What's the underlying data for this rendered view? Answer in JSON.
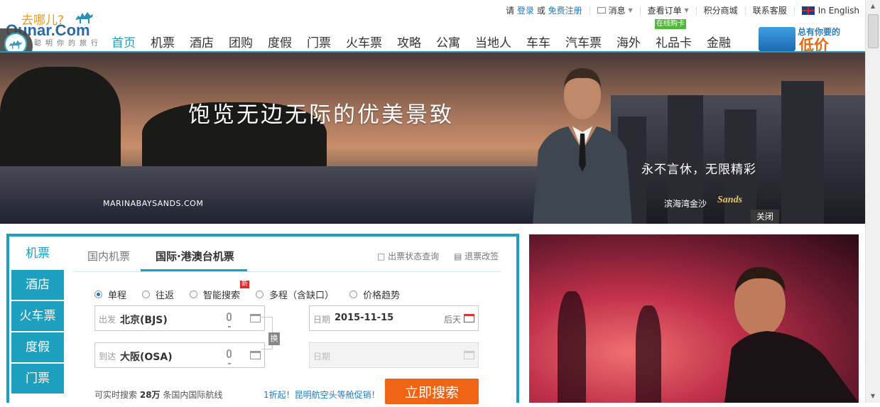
{
  "topbar": {
    "please": "请",
    "login": "登录",
    "or": "或",
    "register": "免费注册",
    "messages": "消息",
    "orders": "查看订单",
    "points_mall": "积分商城",
    "customer_service": "联系客服",
    "english": "In English"
  },
  "logo": {
    "cn": "去哪儿?",
    "en": "Qunar.Com",
    "slogan": "聪明你的旅行"
  },
  "nav": {
    "items": [
      "首页",
      "机票",
      "酒店",
      "团购",
      "度假",
      "门票",
      "火车票",
      "攻略",
      "公寓",
      "当地人",
      "车车",
      "汽车票",
      "海外",
      "礼品卡",
      "金融"
    ],
    "active": "首页",
    "giftcard_badge": "在线购卡"
  },
  "promo": {
    "line1": "总有你要的",
    "line2": "低价"
  },
  "banner": {
    "headline": "饱览无边无际的优美景致",
    "slogan": "永不言休，无限精彩",
    "url": "MARINABAYSANDS.COM",
    "brand_cn": "滨海湾金沙",
    "brand_en": "Sands",
    "close": "关闭"
  },
  "search": {
    "side_tabs": [
      "机票",
      "酒店",
      "火车票",
      "度假",
      "门票"
    ],
    "tabs": [
      "国内机票",
      "国际·港澳台机票"
    ],
    "status_link": "出票状态查询",
    "refund_link": "退票改签",
    "trip_types": [
      "单程",
      "往返",
      "智能搜索",
      "多程（含缺口）",
      "价格趋势"
    ],
    "new_badge": "新",
    "depart_label": "出发",
    "depart_value": "北京(BJS)",
    "arrive_label": "到达",
    "arrive_value": "大阪(OSA)",
    "date_label": "日期",
    "date_value": "2015-11-15",
    "date_hint": "后天",
    "return_label": "日期",
    "swap": "换",
    "footer_left_a": "可实时搜索",
    "footer_left_num": "28万",
    "footer_left_b": "条国内国际航线",
    "footer_promo": "1折起！昆明航空头等舱促销！",
    "search_button": "立即搜索"
  },
  "colors": {
    "brand": "#1d9fbf",
    "button": "#ee6414",
    "link": "#1a7cc5"
  }
}
